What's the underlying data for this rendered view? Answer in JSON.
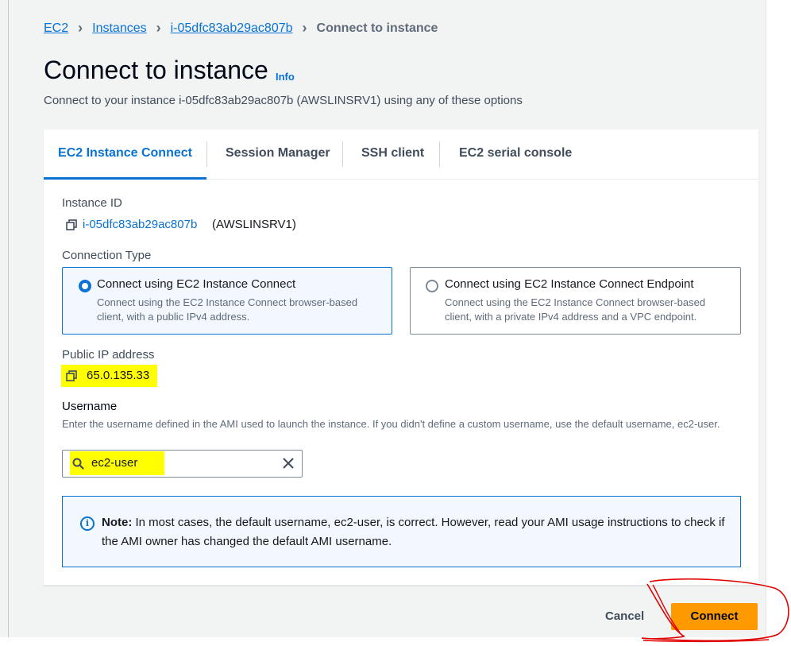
{
  "breadcrumb": {
    "items": [
      "EC2",
      "Instances",
      "i-05dfc83ab29ac807b"
    ],
    "current": "Connect to instance"
  },
  "header": {
    "title": "Connect to instance",
    "info": "Info",
    "subtitle": "Connect to your instance i-05dfc83ab29ac807b (AWSLINSRV1) using any of these options"
  },
  "tabs": [
    "EC2 Instance Connect",
    "Session Manager",
    "SSH client",
    "EC2 serial console"
  ],
  "active_tab": "EC2 Instance Connect",
  "instance": {
    "label": "Instance ID",
    "id": "i-05dfc83ab29ac807b",
    "name": "(AWSLINSRV1)"
  },
  "connection_type": {
    "label": "Connection Type",
    "options": [
      {
        "title": "Connect using EC2 Instance Connect",
        "desc": "Connect using the EC2 Instance Connect browser-based client, with a public IPv4 address.",
        "selected": true
      },
      {
        "title": "Connect using EC2 Instance Connect Endpoint",
        "desc": "Connect using the EC2 Instance Connect browser-based client, with a private IPv4 address and a VPC endpoint.",
        "selected": false
      }
    ]
  },
  "public_ip": {
    "label": "Public IP address",
    "value": "65.0.135.33"
  },
  "username": {
    "label": "Username",
    "description": "Enter the username defined in the AMI used to launch the instance. If you didn't define a custom username, use the default username, ec2-user.",
    "value": "ec2-user"
  },
  "note": {
    "bold": "Note:",
    "text": " In most cases, the default username, ec2-user, is correct. However, read your AMI usage instructions to check if the AMI owner has changed the default AMI username."
  },
  "footer": {
    "cancel": "Cancel",
    "connect": "Connect"
  },
  "colors": {
    "accent": "#0972d3",
    "primary_button": "#ff9900",
    "highlight": "#ffff00",
    "annotation": "#e00000"
  },
  "icons": [
    "copy-icon",
    "search-icon",
    "clear-icon",
    "info-icon",
    "chevron-right-icon"
  ]
}
